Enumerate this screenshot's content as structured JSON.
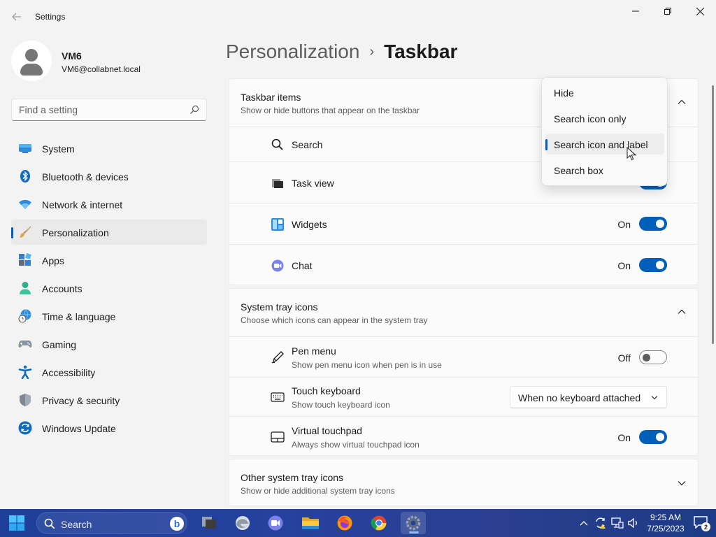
{
  "window": {
    "title": "Settings"
  },
  "profile": {
    "name": "VM6",
    "email": "VM6@collabnet.local"
  },
  "search": {
    "placeholder": "Find a setting"
  },
  "sidebar": {
    "items": [
      {
        "label": "System",
        "icon": "monitor-icon"
      },
      {
        "label": "Bluetooth & devices",
        "icon": "bluetooth-icon"
      },
      {
        "label": "Network & internet",
        "icon": "wifi-icon"
      },
      {
        "label": "Personalization",
        "icon": "brush-icon",
        "selected": true
      },
      {
        "label": "Apps",
        "icon": "apps-icon"
      },
      {
        "label": "Accounts",
        "icon": "person-icon"
      },
      {
        "label": "Time & language",
        "icon": "globe-clock-icon"
      },
      {
        "label": "Gaming",
        "icon": "gamepad-icon"
      },
      {
        "label": "Accessibility",
        "icon": "accessibility-icon"
      },
      {
        "label": "Privacy & security",
        "icon": "shield-icon"
      },
      {
        "label": "Windows Update",
        "icon": "update-icon"
      }
    ]
  },
  "header": {
    "parent": "Personalization",
    "separator": "›",
    "current": "Taskbar"
  },
  "taskbar_items": {
    "title": "Taskbar items",
    "subtitle": "Show or hide buttons that appear on the taskbar",
    "rows": [
      {
        "label": "Search",
        "icon": "search-icon"
      },
      {
        "label": "Task view",
        "icon": "task-view-icon",
        "toggle": true
      },
      {
        "label": "Widgets",
        "icon": "widgets-icon",
        "state": "On",
        "toggle": true
      },
      {
        "label": "Chat",
        "icon": "chat-icon",
        "state": "On",
        "toggle": true
      }
    ]
  },
  "search_dropdown": {
    "options": [
      "Hide",
      "Search icon only",
      "Search icon and label",
      "Search box"
    ],
    "selected": "Search icon and label"
  },
  "system_tray": {
    "title": "System tray icons",
    "subtitle": "Choose which icons can appear in the system tray",
    "rows": [
      {
        "label": "Pen menu",
        "sub": "Show pen menu icon when pen is in use",
        "icon": "pen-icon",
        "state": "Off",
        "toggle": false
      },
      {
        "label": "Touch keyboard",
        "sub": "Show touch keyboard icon",
        "icon": "keyboard-icon",
        "select": "When no keyboard attached"
      },
      {
        "label": "Virtual touchpad",
        "sub": "Always show virtual touchpad icon",
        "icon": "touchpad-icon",
        "state": "On",
        "toggle": true
      }
    ]
  },
  "other_tray": {
    "title": "Other system tray icons",
    "subtitle": "Show or hide additional system tray icons"
  },
  "taskbar": {
    "search_label": "Search",
    "apps": [
      "start-icon",
      "task-view-icon",
      "edge-icon",
      "teams-icon",
      "file-explorer-icon",
      "firefox-icon",
      "chrome-icon",
      "settings-icon"
    ],
    "clock_time": "9:25 AM",
    "clock_date": "7/25/2023",
    "notification_count": "2"
  },
  "colors": {
    "accent": "#005fb8",
    "taskbar": "#26419e"
  }
}
